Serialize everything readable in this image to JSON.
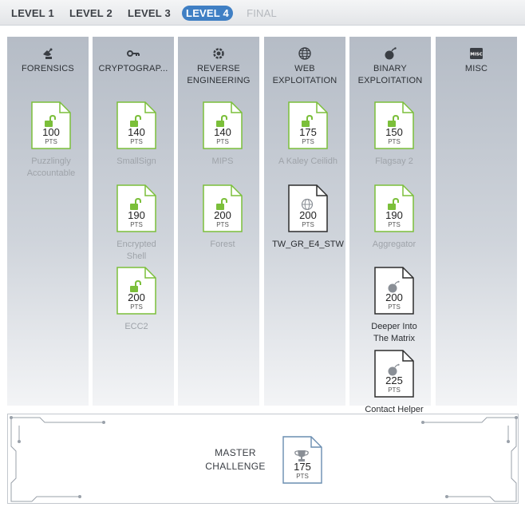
{
  "levels": {
    "tabs": [
      {
        "label": "LEVEL 1"
      },
      {
        "label": "LEVEL 2"
      },
      {
        "label": "LEVEL 3"
      },
      {
        "label": "LEVEL 4"
      },
      {
        "label": "FINAL"
      }
    ],
    "active": "LEVEL 4"
  },
  "columns": [
    {
      "title": "FORENSICS",
      "icon": "satellite-dish-icon"
    },
    {
      "title": "CRYPTOGRAP...",
      "icon": "key-icon"
    },
    {
      "title": "REVERSE\nENGINEERING",
      "icon": "gear-icon"
    },
    {
      "title": "WEB\nEXPLOITATION",
      "icon": "globe-icon"
    },
    {
      "title": "BINARY\nEXPLOITATION",
      "icon": "bomb-icon"
    },
    {
      "title": "MISC",
      "icon": "misc-icon"
    }
  ],
  "pts_label": "PTS",
  "challenges": {
    "forensics": [
      {
        "name": "Puzzlingly\nAccountable",
        "points": "100",
        "status": "unlocked"
      }
    ],
    "cryptography": [
      {
        "name": "SmallSign",
        "points": "140",
        "status": "unlocked"
      },
      {
        "name": "Encrypted\nShell",
        "points": "190",
        "status": "unlocked"
      },
      {
        "name": "ECC2",
        "points": "200",
        "status": "unlocked"
      }
    ],
    "reverse": [
      {
        "name": "MIPS",
        "points": "140",
        "status": "unlocked"
      },
      {
        "name": "Forest",
        "points": "200",
        "status": "unlocked"
      }
    ],
    "web": [
      {
        "name": "A Kaley Ceilidh",
        "points": "175",
        "status": "unlocked"
      },
      {
        "name": "TW_GR_E4_STW",
        "points": "200",
        "status": "locked"
      }
    ],
    "binary": [
      {
        "name": "Flagsay 2",
        "points": "150",
        "status": "unlocked"
      },
      {
        "name": "Aggregator",
        "points": "190",
        "status": "unlocked"
      },
      {
        "name": "Deeper Into\nThe Matrix",
        "points": "200",
        "status": "locked"
      },
      {
        "name": "Contact Helper",
        "points": "225",
        "status": "locked"
      }
    ]
  },
  "master": {
    "title": "MASTER\nCHALLENGE",
    "points": "175",
    "icon": "trophy-icon"
  },
  "colors": {
    "unlocked_green": "#7bbf3a",
    "active_tab": "#3f7fc4",
    "locked_outline": "#2d2d2d"
  }
}
